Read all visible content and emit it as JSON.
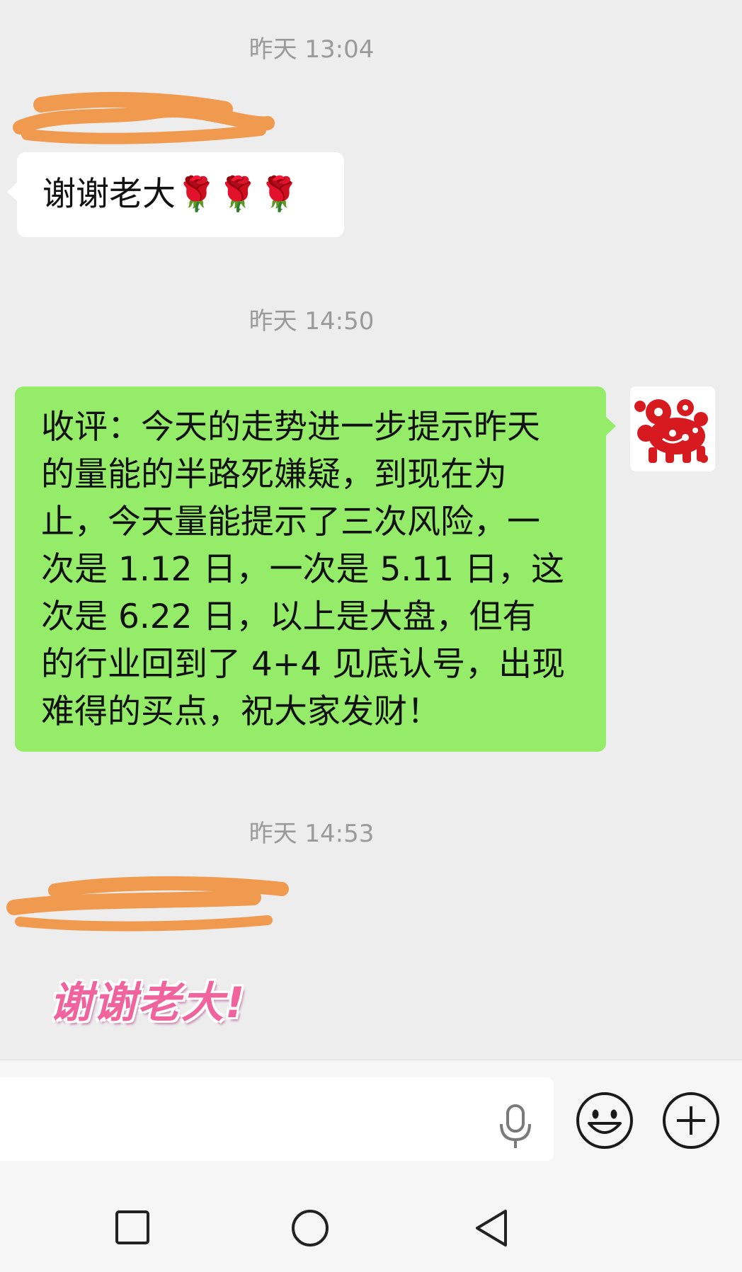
{
  "messages": [
    {
      "timestamp": "昨天 13:04",
      "sender": "other",
      "text": "谢谢老大🌹🌹🌹"
    },
    {
      "timestamp": "昨天 14:50",
      "sender": "me",
      "lines": [
        "收评：今天的走势进一步提示昨天",
        "的量能的半路死嫌疑，到现在为",
        "止，今天量能提示了三次风险，一",
        "次是 1.12 日，一次是 5.11 日，这",
        "次是 6.22 日，以上是大盘，但有",
        "的行业回到了 4+4 见底认号，出现",
        "难得的买点，祝大家发财！"
      ]
    },
    {
      "timestamp": "昨天 14:53",
      "sender": "other",
      "sticker_text": "谢谢老大!"
    }
  ],
  "colors": {
    "chat_bg": "#ededed",
    "bubble_self": "#95ec69",
    "bubble_other": "#ffffff",
    "redaction": "#f09a50",
    "sticker": "#f0639c"
  },
  "input_bar": {
    "icons": [
      "microphone-icon",
      "emoji-icon",
      "plus-icon"
    ]
  },
  "nav_bar": {
    "icons": [
      "recents-square-icon",
      "home-circle-icon",
      "back-triangle-icon"
    ]
  }
}
